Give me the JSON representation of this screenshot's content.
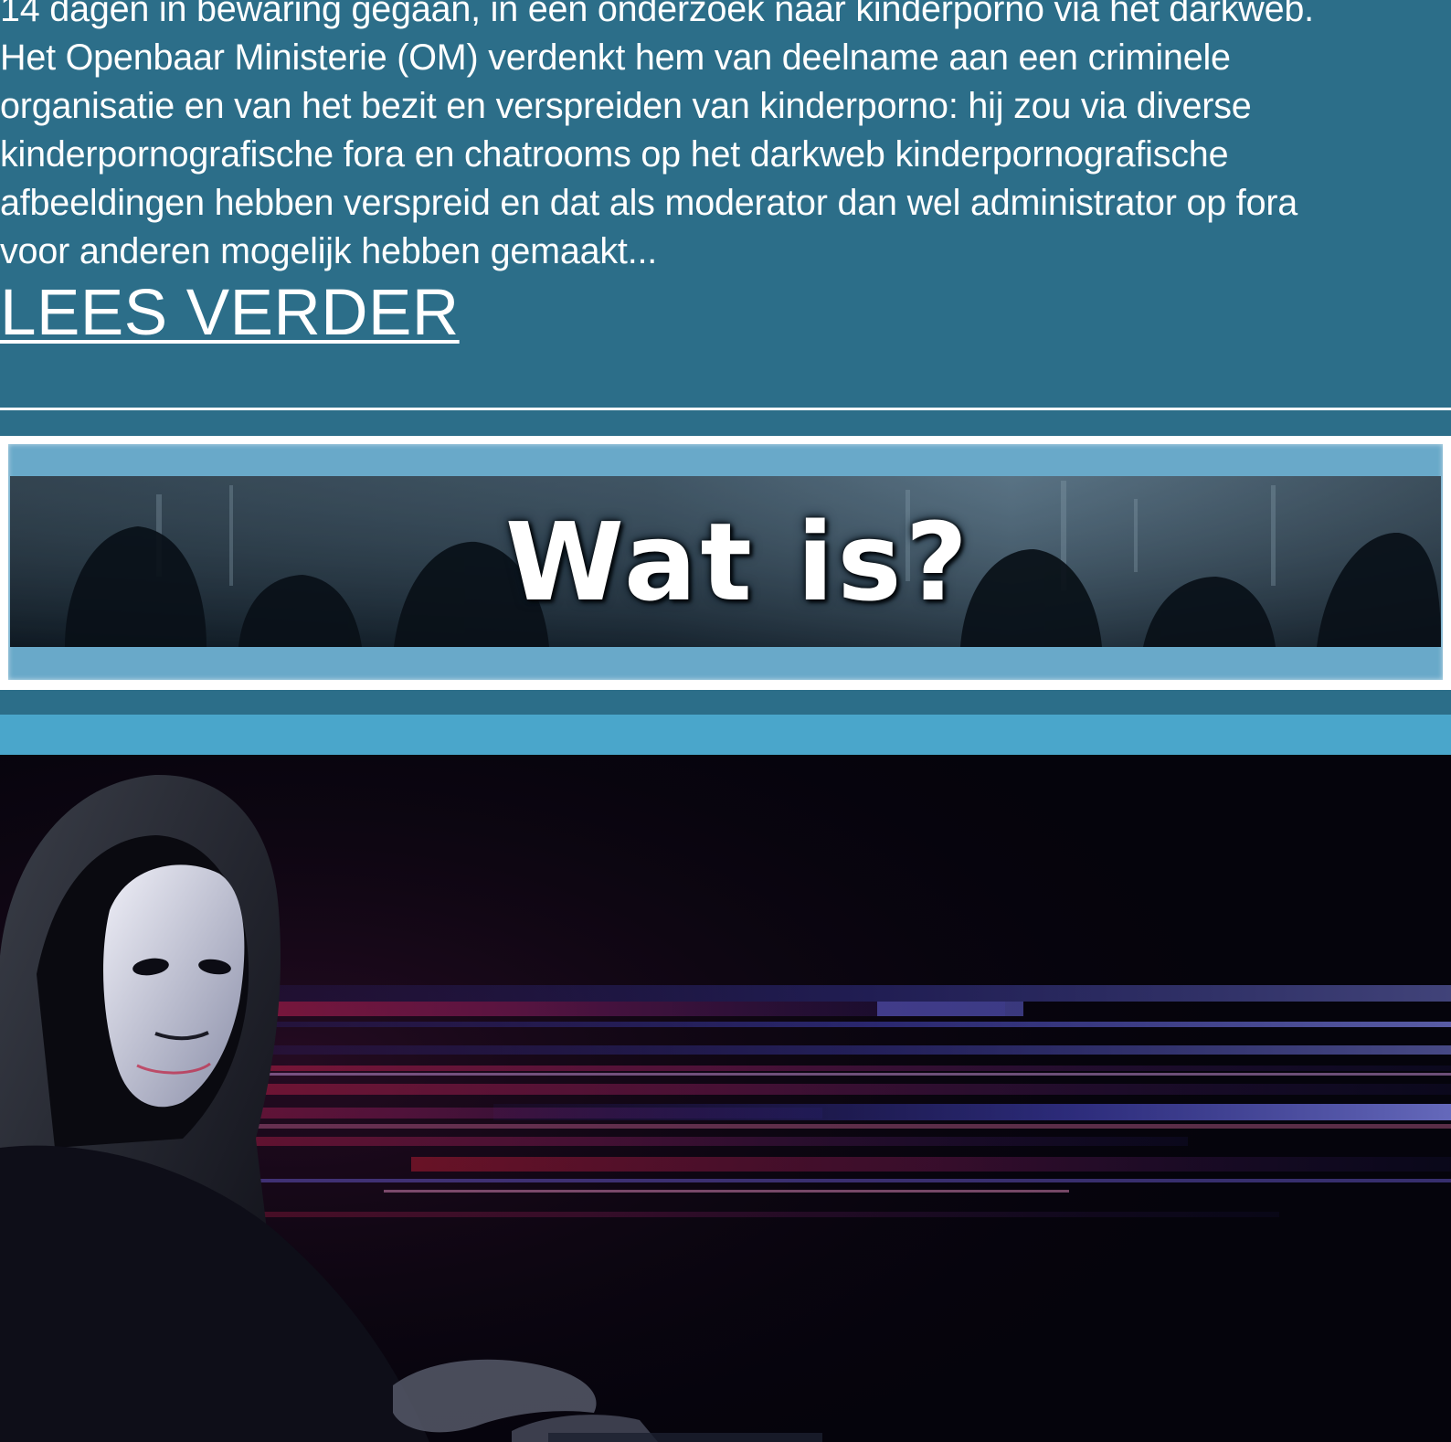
{
  "article": {
    "excerpt": "14 dagen in bewaring gegaan, in een onderzoek naar kinderporno via het darkweb.\nHet Openbaar Ministerie (OM) verdenkt hem van deelname aan een criminele\norganisatie en van het bezit en verspreiden van kinderporno: hij zou via diverse\nkinderpornografische fora en chatrooms op het darkweb kinderpornografische\nafbeeldingen hebben verspreid en dat als moderator dan wel administrator op fora\nvoor anderen mogelijk hebben gemaakt...",
    "read_more_label": "LEES VERDER"
  },
  "banner": {
    "title": "Wat is?"
  },
  "colors": {
    "page_background": "#2c6e89",
    "banner_border": "#69a9c9",
    "band": "#4aa6cb",
    "hero_background": "#05040c",
    "text": "#ffffff"
  }
}
